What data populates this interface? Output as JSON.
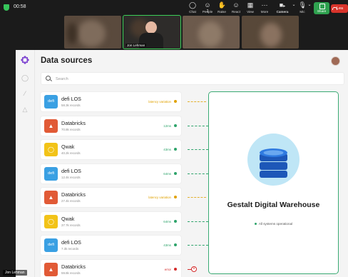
{
  "zoom": {
    "timer": "00:58",
    "toolbar": [
      {
        "label": "Chat",
        "icon": "chat-icon"
      },
      {
        "label": "People",
        "icon": "people-icon",
        "count": "2"
      },
      {
        "label": "Raise",
        "icon": "raise-hand-icon"
      },
      {
        "label": "React",
        "icon": "react-icon"
      },
      {
        "label": "View",
        "icon": "view-icon"
      },
      {
        "label": "More",
        "icon": "more-icon"
      },
      {
        "label": "Camera",
        "icon": "camera-icon"
      },
      {
        "label": "Mic",
        "icon": "mic-icon"
      },
      {
        "label": "Share",
        "icon": "share-icon"
      },
      {
        "label": "Lea",
        "icon": "leave-icon"
      }
    ],
    "participants": [
      {
        "name": ""
      },
      {
        "name": "Jon Lehman"
      },
      {
        "name": ""
      },
      {
        "name": ""
      }
    ],
    "self_name": "Jon Lehman"
  },
  "app": {
    "title": "Data sources",
    "search": {
      "placeholder": "Search",
      "value": ""
    },
    "sources": [
      {
        "name": "defi LOS",
        "records": "58.3k records",
        "latency": "latency variation",
        "status": "warn",
        "kind": "defi"
      },
      {
        "name": "Databricks",
        "records": "70.8k records",
        "latency": "12ms",
        "status": "ok",
        "kind": "databricks"
      },
      {
        "name": "Qwak",
        "records": "40.2k records",
        "latency": "43ms",
        "status": "ok",
        "kind": "qwak"
      },
      {
        "name": "defi LOS",
        "records": "12.4k records",
        "latency": "64ms",
        "status": "ok",
        "kind": "defi"
      },
      {
        "name": "Databricks",
        "records": "27.4k records",
        "latency": "latency variation",
        "status": "warn",
        "kind": "databricks"
      },
      {
        "name": "Qwak",
        "records": "37.7k records",
        "latency": "64ms",
        "status": "ok",
        "kind": "qwak"
      },
      {
        "name": "defi LOS",
        "records": "7.3k records",
        "latency": "43ms",
        "status": "ok",
        "kind": "defi"
      },
      {
        "name": "Databricks",
        "records": "59.8k records",
        "latency": "error",
        "status": "error",
        "kind": "databricks"
      }
    ],
    "warehouse": {
      "title": "Gestalt Digital Warehouse",
      "status": "All systems operational"
    },
    "colors": {
      "ok": "#2da36a",
      "warn": "#e0a100",
      "error": "#d42a2a",
      "defi": "#3aa0e3",
      "databricks": "#e15a36",
      "qwak": "#f2c318",
      "accent": "#7b3fd0"
    }
  }
}
